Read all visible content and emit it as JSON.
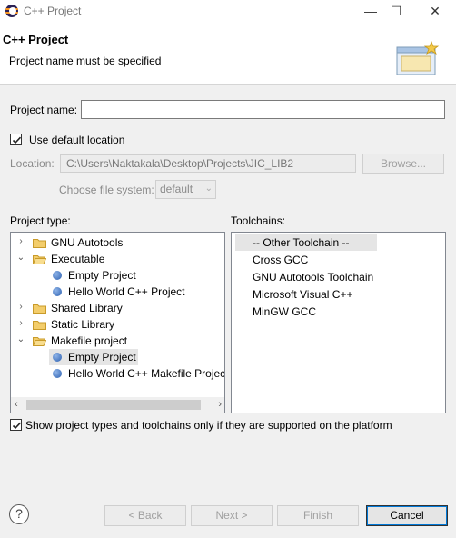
{
  "window": {
    "title": "C++ Project",
    "minimize_glyph": "—",
    "maximize_glyph": "☐",
    "close_glyph": "✕"
  },
  "banner": {
    "title": "C++ Project",
    "message": "Project name must be specified",
    "icon": "new-project-wizard-icon"
  },
  "form": {
    "project_name_label": "Project name:",
    "project_name_value": "",
    "use_default_location_label": "Use default location",
    "use_default_location_checked": true,
    "location_label": "Location:",
    "location_value": "C:\\Users\\Naktakala\\Desktop\\Projects\\JIC_LIB2",
    "browse_button": "Browse...",
    "choose_fs_label": "Choose file system:",
    "choose_fs_value": "default"
  },
  "project_type": {
    "label": "Project type:",
    "items": [
      {
        "label": "GNU Autotools",
        "kind": "folder",
        "expanded": false
      },
      {
        "label": "Executable",
        "kind": "folder",
        "expanded": true
      },
      {
        "label": "Empty Project",
        "kind": "item"
      },
      {
        "label": "Hello World C++ Project",
        "kind": "item"
      },
      {
        "label": "Shared Library",
        "kind": "folder",
        "expanded": false
      },
      {
        "label": "Static Library",
        "kind": "folder",
        "expanded": false
      },
      {
        "label": "Makefile project",
        "kind": "folder",
        "expanded": true
      },
      {
        "label": "Empty Project",
        "kind": "item",
        "selected": true
      },
      {
        "label": "Hello World C++ Makefile Project",
        "kind": "item"
      }
    ]
  },
  "toolchains": {
    "label": "Toolchains:",
    "items": [
      {
        "label": "-- Other Toolchain --",
        "selected": true
      },
      {
        "label": "Cross GCC"
      },
      {
        "label": "GNU Autotools Toolchain"
      },
      {
        "label": "Microsoft Visual C++"
      },
      {
        "label": "MinGW GCC"
      }
    ]
  },
  "show_supported_label": "Show project types and toolchains only if they are supported on the platform",
  "show_supported_checked": true,
  "buttons": {
    "help": "?",
    "back": "< Back",
    "next": "Next >",
    "finish": "Finish",
    "cancel": "Cancel"
  },
  "colors": {
    "accent": "#0078d7",
    "selection": "#e5e5e5",
    "folder": "#e8b84a"
  }
}
